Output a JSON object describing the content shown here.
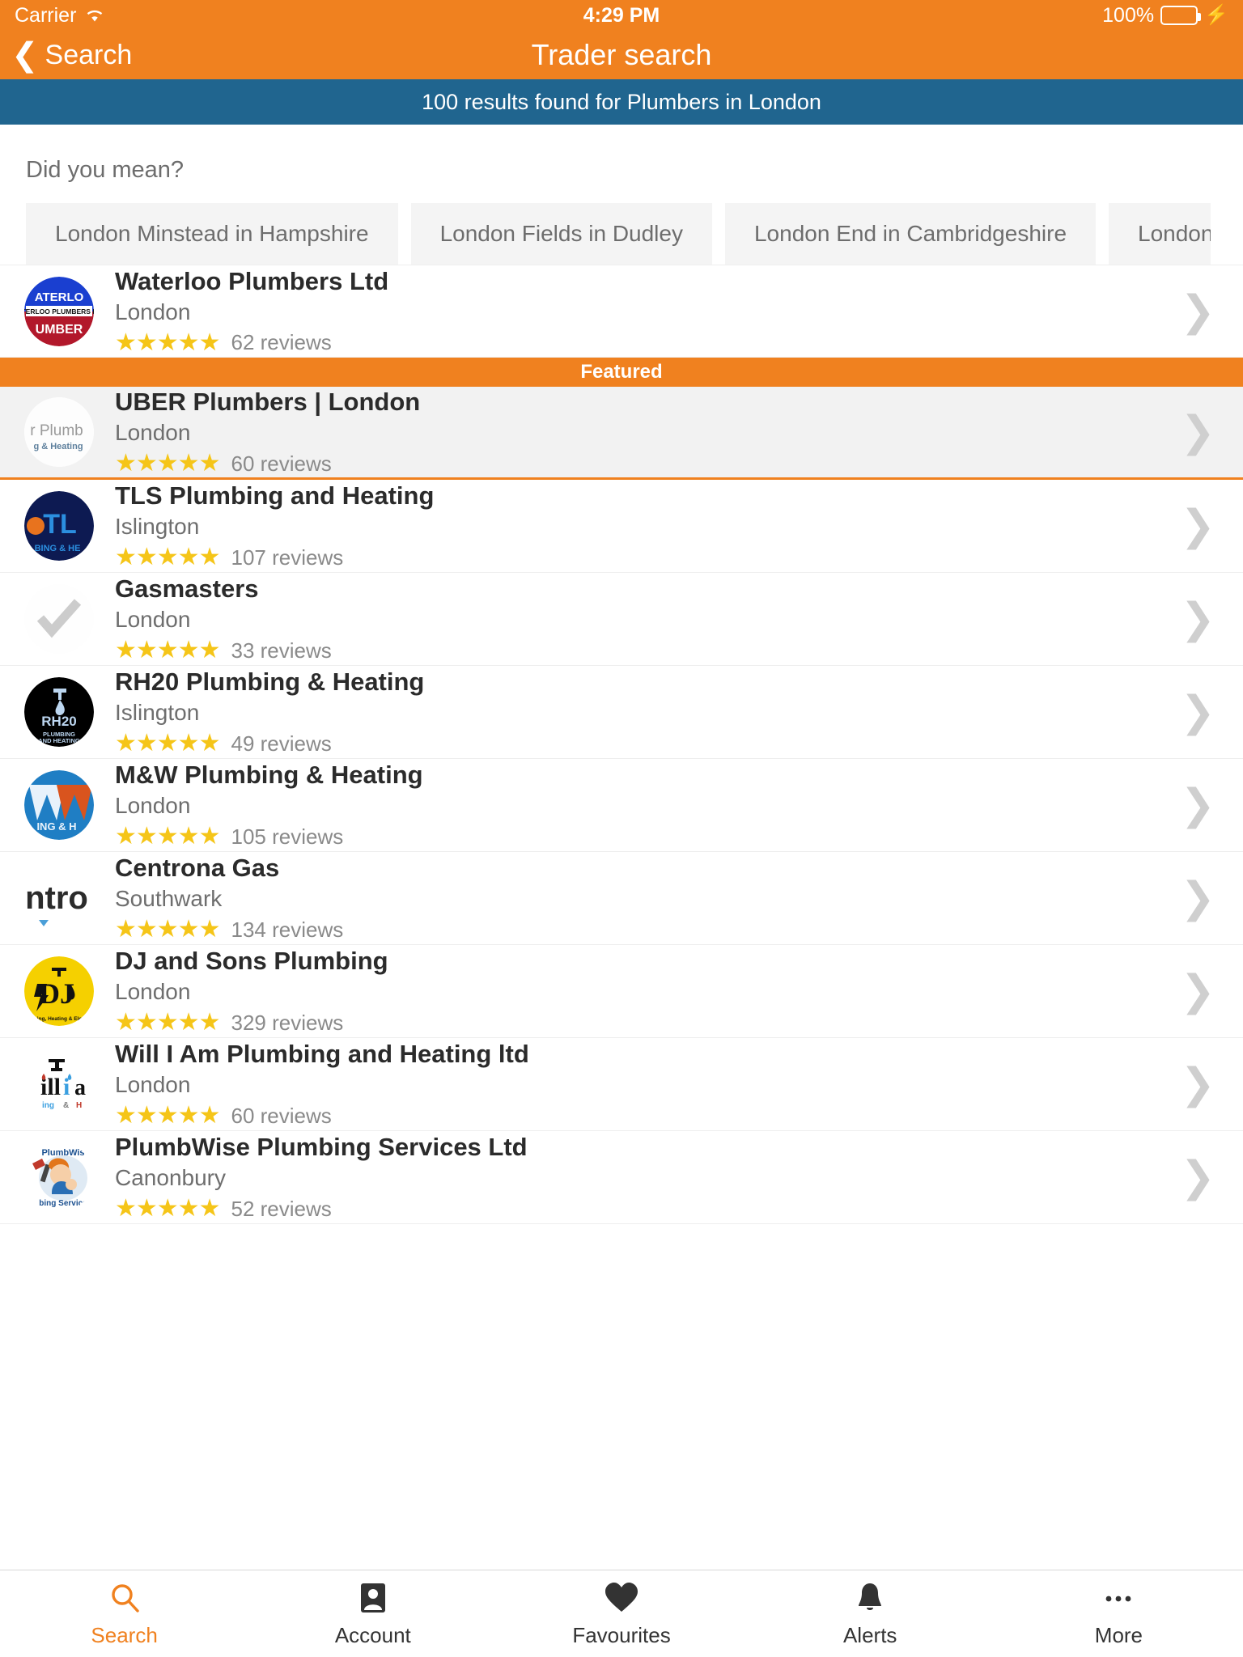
{
  "status_bar": {
    "carrier": "Carrier",
    "wifi_icon": "wifi-icon",
    "time": "4:29 PM",
    "battery_percent": "100%",
    "battery_icon": "battery-full-icon",
    "charging_icon": "lightning-bolt-icon"
  },
  "nav": {
    "back_label": "Search",
    "back_icon": "chevron-left-icon",
    "title": "Trader search"
  },
  "results_banner": {
    "text": "100 results found for Plumbers in London",
    "background_color": "#20658F"
  },
  "suggestions": {
    "title": "Did you mean?",
    "chips": [
      "London Minstead in Hampshire",
      "London Fields in Dudley",
      "London End in Cambridgeshire",
      "London Coln"
    ]
  },
  "featured_banner": {
    "label": "Featured",
    "background_color": "#F0811F"
  },
  "colors": {
    "accent_orange": "#F0811F",
    "banner_blue": "#20658F",
    "star_yellow": "#F5C518",
    "featured_row_bg": "#F2F2F2"
  },
  "traders": [
    {
      "name": "Waterloo Plumbers Ltd",
      "location": "London",
      "stars": "★★★★★",
      "rating": 5,
      "reviews": "62 reviews",
      "review_count": 62,
      "logo_name": "waterloo-plumbers-logo",
      "featured": false
    },
    {
      "name": "UBER Plumbers | London",
      "location": "London",
      "stars": "★★★★★",
      "rating": 5,
      "reviews": "60 reviews",
      "review_count": 60,
      "logo_name": "uber-plumbers-logo",
      "featured": true
    },
    {
      "name": "TLS Plumbing and Heating",
      "location": "Islington",
      "stars": "★★★★★",
      "rating": 5,
      "reviews": "107 reviews",
      "review_count": 107,
      "logo_name": "tls-plumbing-logo",
      "featured": false
    },
    {
      "name": "Gasmasters",
      "location": "London",
      "stars": "★★★★★",
      "rating": 5,
      "reviews": "33 reviews",
      "review_count": 33,
      "logo_name": "gasmasters-logo",
      "featured": false
    },
    {
      "name": "RH20 Plumbing & Heating",
      "location": "Islington",
      "stars": "★★★★★",
      "rating": 5,
      "reviews": "49 reviews",
      "review_count": 49,
      "logo_name": "rh20-plumbing-logo",
      "featured": false
    },
    {
      "name": "M&W Plumbing & Heating",
      "location": "London",
      "stars": "★★★★★",
      "rating": 5,
      "reviews": "105 reviews",
      "review_count": 105,
      "logo_name": "mw-plumbing-logo",
      "featured": false
    },
    {
      "name": "Centrona Gas",
      "location": "Southwark",
      "stars": "★★★★★",
      "rating": 5,
      "reviews": "134 reviews",
      "review_count": 134,
      "logo_name": "centrona-gas-logo",
      "featured": false
    },
    {
      "name": "DJ and Sons Plumbing",
      "location": "London",
      "stars": "★★★★★",
      "rating": 5,
      "reviews": "329 reviews",
      "review_count": 329,
      "logo_name": "dj-and-sons-logo",
      "featured": false
    },
    {
      "name": "Will I Am Plumbing and Heating ltd",
      "location": "London",
      "stars": "★★★★★",
      "rating": 5,
      "reviews": "60 reviews",
      "review_count": 60,
      "logo_name": "will-i-am-plumbing-logo",
      "featured": false
    },
    {
      "name": "PlumbWise Plumbing Services Ltd",
      "location": "Canonbury",
      "stars": "★★★★★",
      "rating": 5,
      "reviews": "52 reviews",
      "review_count": 52,
      "logo_name": "plumbwise-logo",
      "featured": false
    }
  ],
  "tab_bar": {
    "tabs": [
      {
        "label": "Search",
        "icon": "search-icon",
        "active": true
      },
      {
        "label": "Account",
        "icon": "person-card-icon",
        "active": false
      },
      {
        "label": "Favourites",
        "icon": "heart-icon",
        "active": false
      },
      {
        "label": "Alerts",
        "icon": "bell-icon",
        "active": false
      },
      {
        "label": "More",
        "icon": "ellipsis-icon",
        "active": false
      }
    ]
  }
}
